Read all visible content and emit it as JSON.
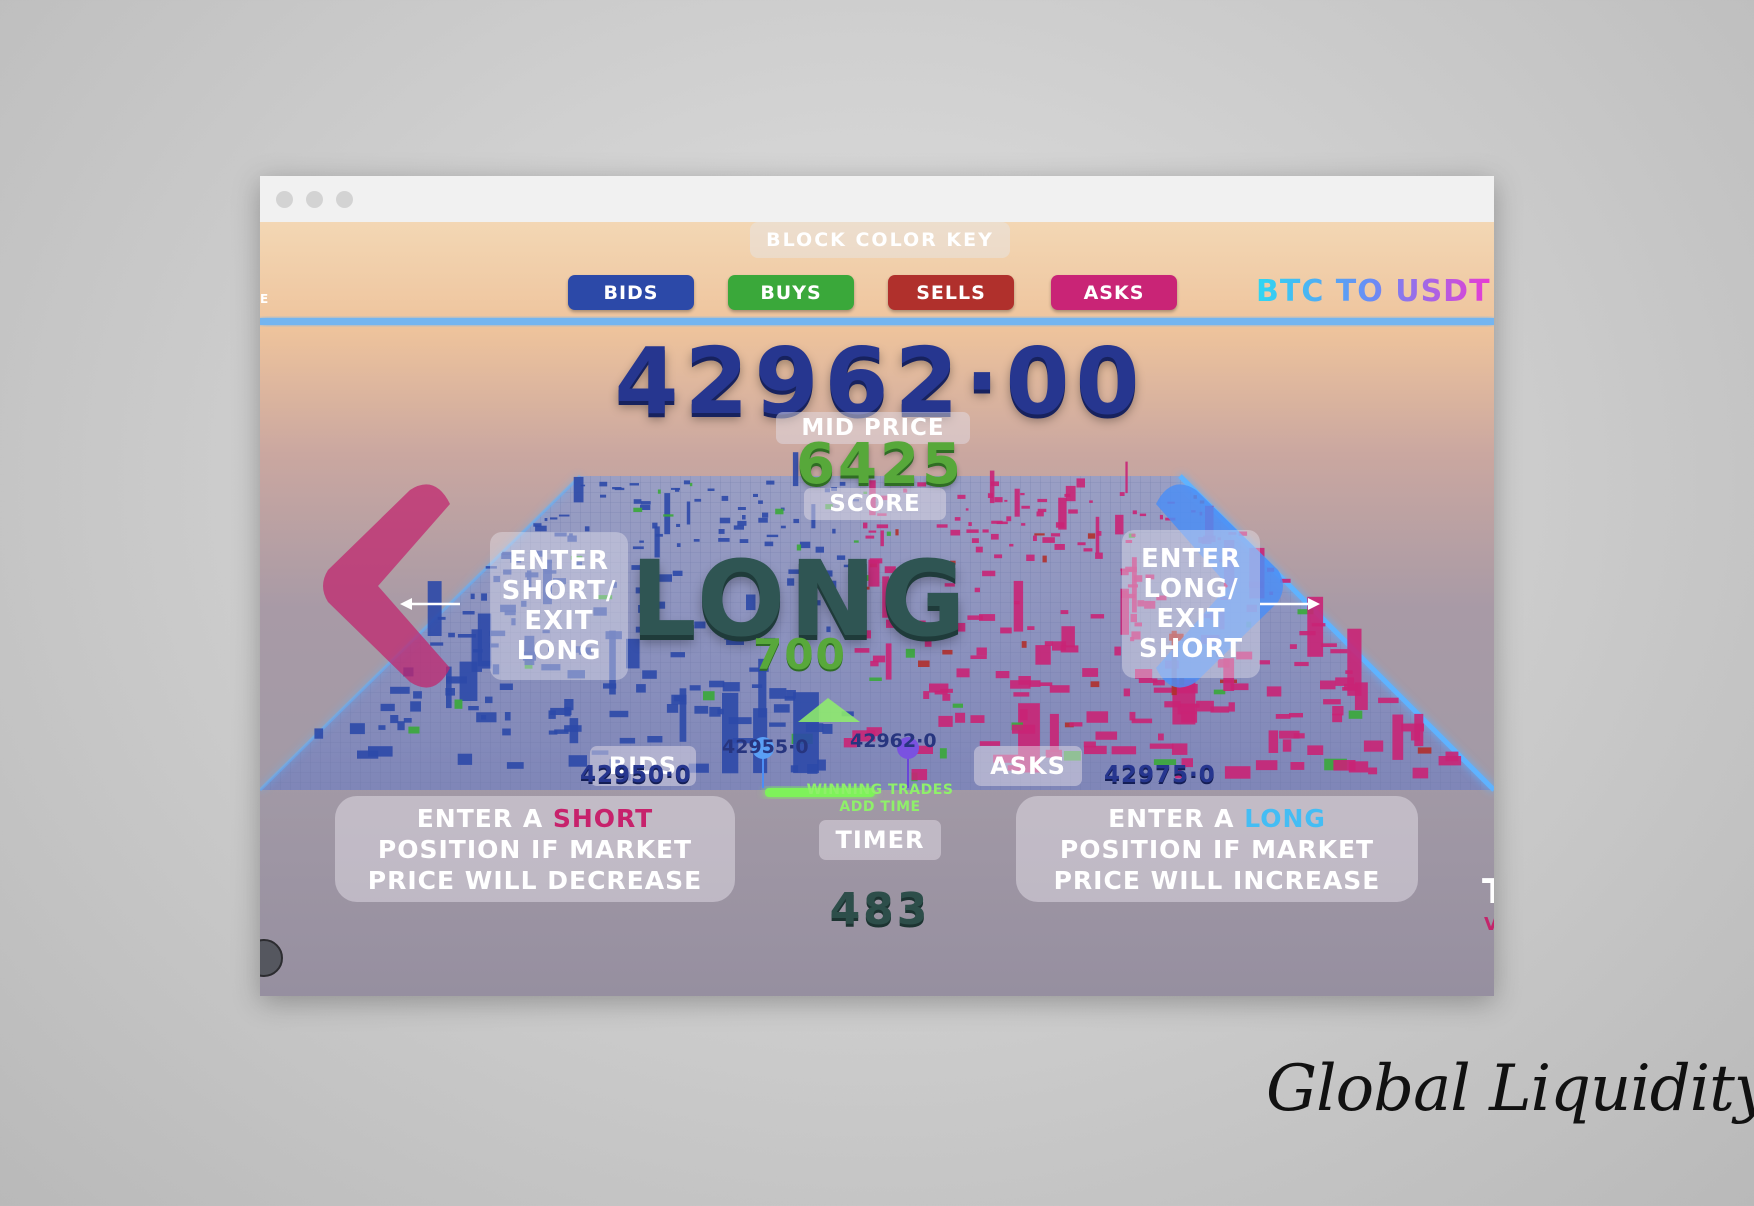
{
  "window": {
    "controls": [
      "window-dot-1",
      "window-dot-2",
      "window-dot-3"
    ]
  },
  "color_key": {
    "title": "BLOCK COLOR KEY",
    "items": [
      {
        "label": "BIDS",
        "color": "#2c49a8"
      },
      {
        "label": "BUYS",
        "color": "#3aa83a"
      },
      {
        "label": "SELLS",
        "color": "#b0302c"
      },
      {
        "label": "ASKS",
        "color": "#c92476"
      }
    ]
  },
  "pair": "BTC TO USDT",
  "edge_text": "E",
  "mid_price": {
    "value": "42962·00",
    "label": "MID PRICE"
  },
  "score": {
    "value": "6425",
    "label": "SCORE"
  },
  "position": "LONG",
  "left_action": {
    "lines": [
      "ENTER",
      "SHORT/",
      "EXIT",
      "LONG"
    ]
  },
  "right_action": {
    "lines": [
      "ENTER",
      "LONG/",
      "EXIT",
      "SHORT"
    ]
  },
  "pnl": "700",
  "entry_prices": {
    "left": "42955·0",
    "right": "42962·0"
  },
  "board_labels": {
    "bids": "BIDS",
    "asks": "ASKS"
  },
  "axis": {
    "low": "42950·0",
    "high": "42975·0"
  },
  "hint": {
    "line1": "WINNING TRADES",
    "line2": "ADD TIME"
  },
  "timer": {
    "label": "TIMER",
    "value": "483"
  },
  "short_instruction": {
    "prefix": "ENTER A ",
    "keyword": "SHORT",
    "line2": "POSITION IF MARKET",
    "line3": "PRICE WILL DECREASE"
  },
  "long_instruction": {
    "prefix": "ENTER A ",
    "keyword": "LONG",
    "line2": "POSITION IF MARKET",
    "line3": "PRICE WILL INCREASE"
  },
  "corner": {
    "t": "T",
    "v": "V"
  },
  "colors": {
    "bids": "#2c49a8",
    "buys": "#3aa83a",
    "sells": "#b0302c",
    "asks": "#c92476",
    "price": "#26368f",
    "score": "#57a83a",
    "position": "#2f5553",
    "glow": "#5fb3ff",
    "short_keyword": "#c7226c",
    "long_keyword": "#44bdf4"
  },
  "brand": "Global Liquidity"
}
